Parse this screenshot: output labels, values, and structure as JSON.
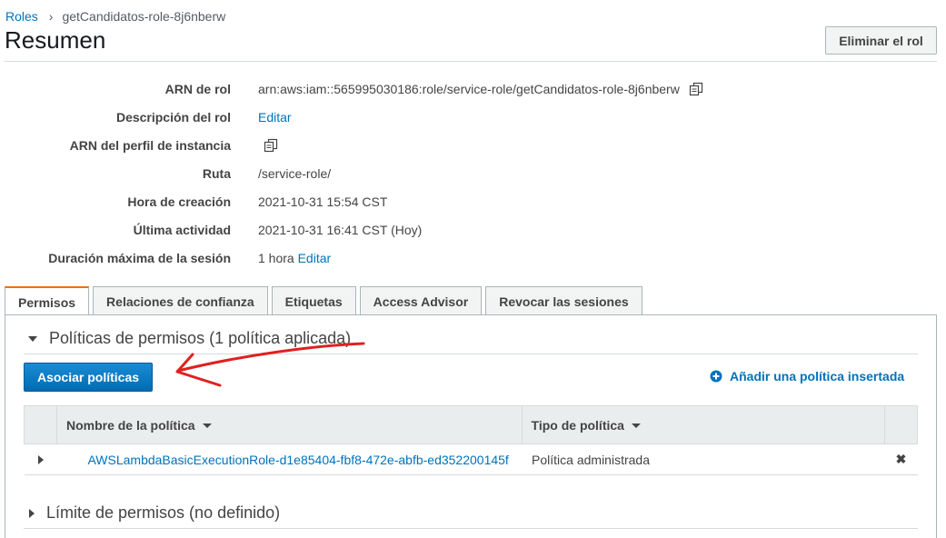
{
  "breadcrumb": {
    "roles_link": "Roles",
    "current": "getCandidatos-role-8j6nberw"
  },
  "page": {
    "title": "Resumen",
    "delete_button": "Eliminar el rol"
  },
  "summary": {
    "arn_label": "ARN de rol",
    "arn_value": "arn:aws:iam::565995030186:role/service-role/getCandidatos-role-8j6nberw",
    "description_label": "Descripción del rol",
    "description_link": "Editar",
    "instance_profile_label": "ARN del perfil de instancia",
    "path_label": "Ruta",
    "path_value": "/service-role/",
    "created_label": "Hora de creación",
    "created_value": "2021-10-31 15:54 CST",
    "last_activity_label": "Última actividad",
    "last_activity_value": "2021-10-31 16:41 CST (Hoy)",
    "max_session_label": "Duración máxima de la sesión",
    "max_session_value": "1 hora",
    "max_session_link": "Editar"
  },
  "tabs": [
    {
      "label": "Permisos",
      "active": true
    },
    {
      "label": "Relaciones de confianza"
    },
    {
      "label": "Etiquetas"
    },
    {
      "label": "Access Advisor"
    },
    {
      "label": "Revocar las sesiones"
    }
  ],
  "permissions": {
    "section_title": "Políticas de permisos (1 política aplicada)",
    "attach_button": "Asociar políticas",
    "add_inline_link": "Añadir una política insertada",
    "table": {
      "col_name": "Nombre de la política",
      "col_type": "Tipo de política",
      "rows": [
        {
          "name": "AWSLambdaBasicExecutionRole-d1e85404-fbf8-472e-abfb-ed352200145f",
          "type": "Política administrada"
        }
      ]
    },
    "boundary_title": "Límite de permisos (no definido)"
  },
  "colors": {
    "link": "#0073bb",
    "primary_button": "#0073bb",
    "active_tab_accent": "#ec7211",
    "annotation_arrow": "#e02020"
  },
  "icons": {
    "copy": "copy-icon",
    "add": "plus-circle-icon",
    "remove": "close-icon"
  }
}
